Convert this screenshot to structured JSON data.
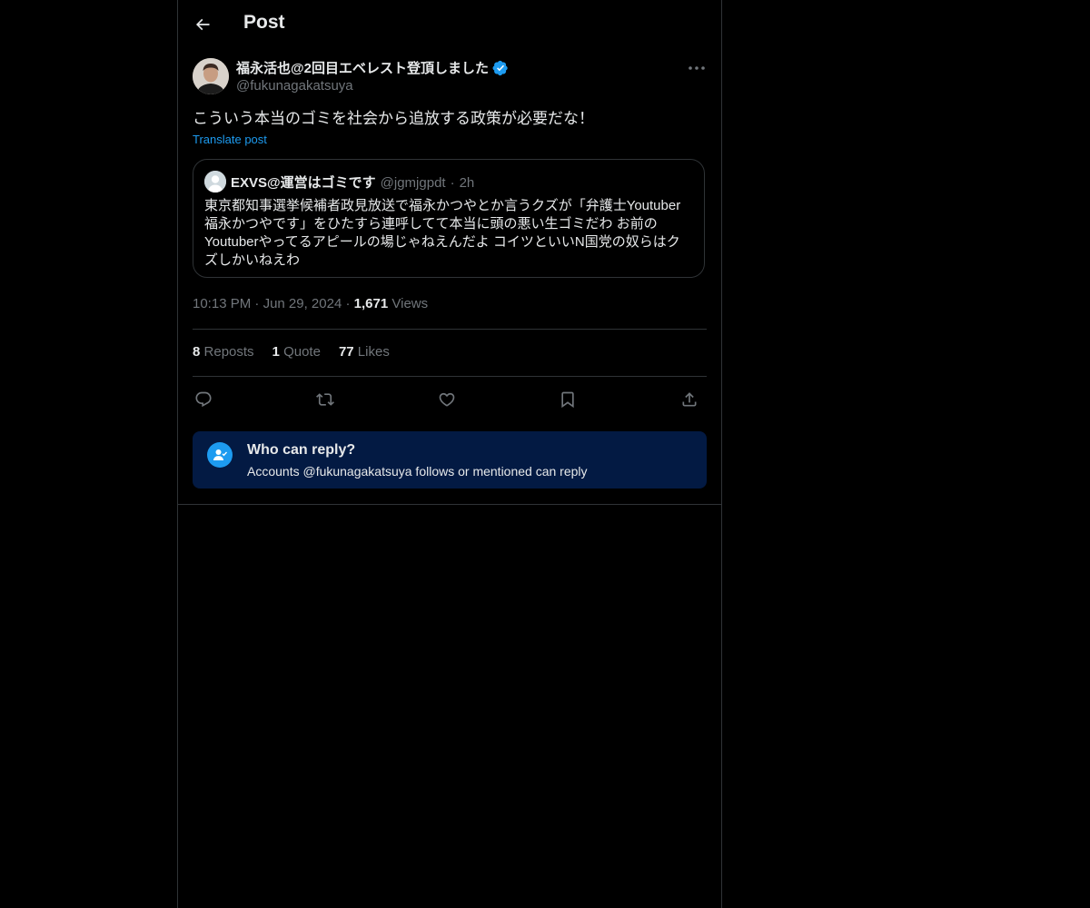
{
  "header": {
    "title": "Post"
  },
  "post": {
    "author_name": "福永活也@2回目エベレスト登頂しました",
    "author_handle": "@fukunagakatsuya",
    "text": "こういう本当のゴミを社会から追放する政策が必要だな！",
    "translate_label": "Translate post",
    "quoted": {
      "name": "EXVS@運営はゴミです",
      "handle": "@jgmjgpdt",
      "separator": "·",
      "time": "2h",
      "text": "東京都知事選挙候補者政見放送で福永かつやとか言うクズが「弁護士Youtuber福永かつやです」をひたすら連呼してて本当に頭の悪い生ゴミだわ お前のYoutuberやってるアピールの場じゃねえんだよ コイツといいN国党の奴らはクズしかいねえわ"
    },
    "time": "10:13 PM",
    "dot": "·",
    "date": "Jun 29, 2024",
    "views_count": "1,671",
    "views_label": "Views",
    "stats": {
      "reposts_count": "8",
      "reposts_label": "Reposts",
      "quotes_count": "1",
      "quotes_label": "Quote",
      "likes_count": "77",
      "likes_label": "Likes"
    }
  },
  "reply_restriction": {
    "title": "Who can reply?",
    "subtitle": "Accounts @fukunagakatsuya follows or mentioned can reply"
  },
  "colors": {
    "accent": "#1d9bf0",
    "background": "#000000",
    "muted": "#71767b",
    "border": "#2f3336",
    "reply_box": "#031a43"
  }
}
